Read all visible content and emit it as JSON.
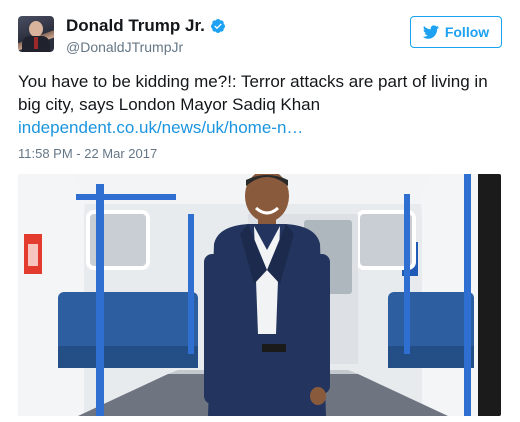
{
  "author": {
    "display_name": "Donald Trump Jr.",
    "handle": "@DonaldJTrumpJr",
    "verified": true,
    "avatar_icon": "profile-avatar"
  },
  "follow_button": {
    "label": "Follow",
    "icon": "twitter-bird-icon",
    "color": "#1da1f2"
  },
  "tweet": {
    "text": "You have to be kidding me?!: Terror attacks are part of living in big city, says London Mayor Sadiq Khan ",
    "link_text": "independent.co.uk/news/uk/home-n…",
    "link_color": "#1b95e0",
    "timestamp": "11:58 PM - 22 Mar 2017"
  },
  "media": {
    "kind": "photo",
    "icon": "photo-image"
  }
}
